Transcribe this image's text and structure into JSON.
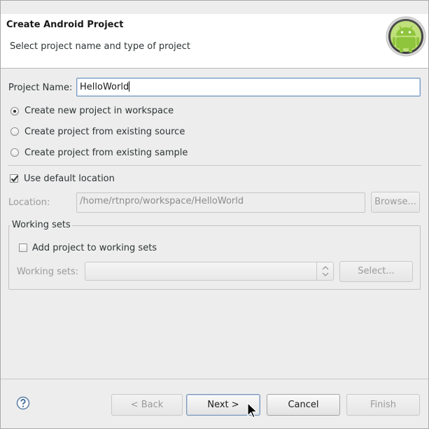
{
  "header": {
    "title": "Create Android Project",
    "subtitle": "Select project name and type of project",
    "logo_icon": "android-robot-icon"
  },
  "project": {
    "name_label": "Project Name:",
    "name_value": "HelloWorld"
  },
  "project_type": {
    "options": [
      {
        "label": "Create new project in workspace",
        "checked": true
      },
      {
        "label": "Create project from existing source",
        "checked": false
      },
      {
        "label": "Create project from existing sample",
        "checked": false
      }
    ]
  },
  "location": {
    "use_default_label": "Use default location",
    "use_default_checked": true,
    "location_label": "Location:",
    "location_value": "/home/rtnpro/workspace/HelloWorld",
    "browse_label": "Browse..."
  },
  "working_sets": {
    "group_title": "Working sets",
    "add_label": "Add project to working sets",
    "add_checked": false,
    "sets_label": "Working sets:",
    "sets_value": "",
    "select_label": "Select..."
  },
  "footer": {
    "help_icon": "help-question-icon",
    "back_label": "< Back",
    "next_label": "Next >",
    "cancel_label": "Cancel",
    "finish_label": "Finish"
  },
  "colors": {
    "android_green": "#8fc43d",
    "focus_border": "#7a9cc4"
  }
}
